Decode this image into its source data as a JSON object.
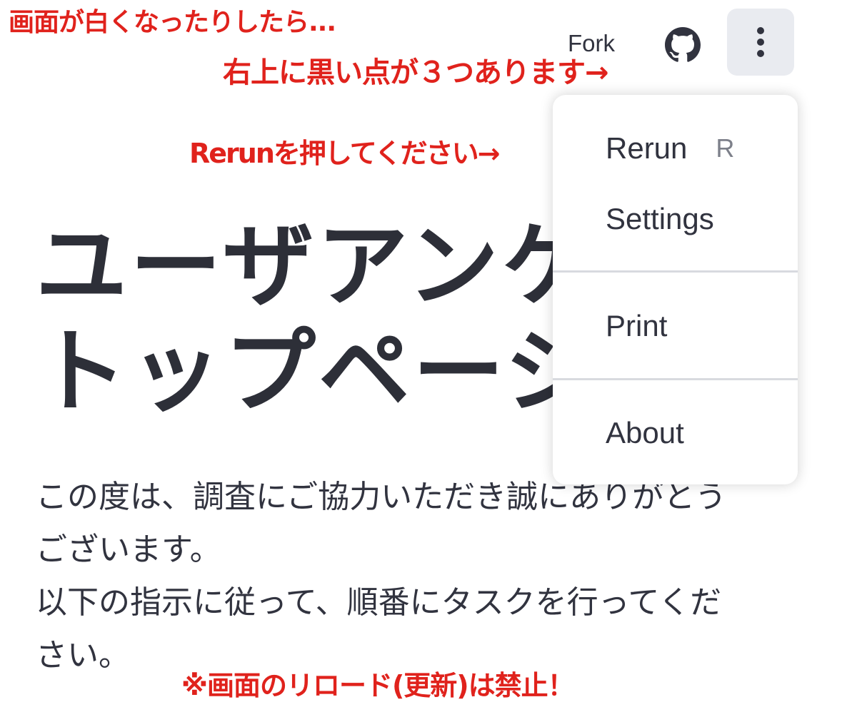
{
  "annotations": {
    "line1": "画面が白くなったりしたら...",
    "line2": "右上に黒い点が３つあります→",
    "line3": "Rerunを押してください→",
    "line4": "※画面のリロード(更新)は禁止！"
  },
  "header": {
    "fork_label": "Fork",
    "github_icon": "github-icon",
    "menu_icon": "vertical-ellipsis-icon"
  },
  "main": {
    "title_line1": "ユーザアンケ",
    "title_line2": "トップページ",
    "intro_line1": "この度は、調査にご協力いただき誠にありがとう",
    "intro_line2": "ございます。",
    "intro_line3": "以下の指示に従って、順番にタスクを行ってくだ",
    "intro_line4": "さい。"
  },
  "menu": {
    "rerun_label": "Rerun",
    "rerun_shortcut": "R",
    "settings_label": "Settings",
    "print_label": "Print",
    "about_label": "About"
  },
  "colors": {
    "annotation": "#e0221c",
    "text": "#31333f",
    "menu_button_bg": "#e9ebf0"
  }
}
